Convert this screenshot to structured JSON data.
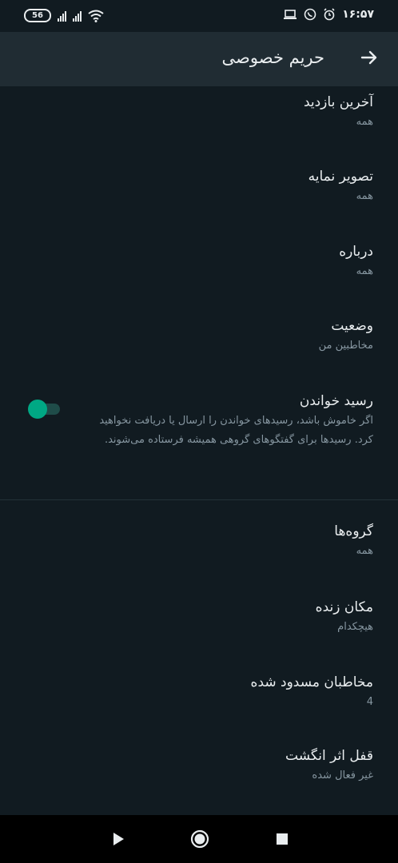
{
  "status_bar": {
    "battery": "56",
    "time": "۱۶:۵۷"
  },
  "header": {
    "title": "حریم خصوصی",
    "back_icon": "arrow-right-icon"
  },
  "items": [
    {
      "title": "آخرین بازدید",
      "sub": "همه"
    },
    {
      "title": "تصویر نمایه",
      "sub": "همه"
    },
    {
      "title": "درباره",
      "sub": "همه"
    },
    {
      "title": "وضعیت",
      "sub": "مخاطبین من"
    },
    {
      "title": "رسید خواندن",
      "sub": "اگر خاموش باشد، رسیدهای خواندن را ارسال یا دریافت نخواهید کرد. رسیدها برای گفتگوهای گروهی همیشه فرستاده می‌شوند.",
      "toggle": "off"
    },
    {
      "title": "گروه‌ها",
      "sub": "همه"
    },
    {
      "title": "مکان زنده",
      "sub": "هیچکدام"
    },
    {
      "title": "مخاطبان مسدود شده",
      "sub": "4"
    },
    {
      "title": "قفل اثر انگشت",
      "sub": "غیر فعال شده"
    }
  ],
  "colors": {
    "background": "#111b21",
    "header": "#202c33",
    "accent": "#00a884",
    "secondary_text": "#8696a0"
  }
}
